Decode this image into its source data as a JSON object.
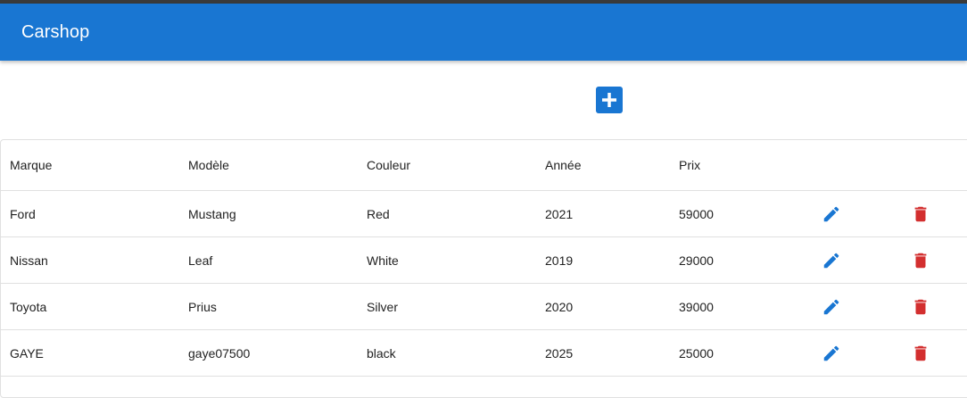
{
  "app": {
    "title": "Carshop"
  },
  "toolbar": {
    "add_icon": "plus-icon"
  },
  "table": {
    "columns": [
      "Marque",
      "Modèle",
      "Couleur",
      "Année",
      "Prix"
    ],
    "rows": [
      {
        "marque": "Ford",
        "modele": "Mustang",
        "couleur": "Red",
        "annee": "2021",
        "prix": "59000"
      },
      {
        "marque": "Nissan",
        "modele": "Leaf",
        "couleur": "White",
        "annee": "2019",
        "prix": "29000"
      },
      {
        "marque": "Toyota",
        "modele": "Prius",
        "couleur": "Silver",
        "annee": "2020",
        "prix": "39000"
      },
      {
        "marque": "GAYE",
        "modele": "gaye07500",
        "couleur": "black",
        "annee": "2025",
        "prix": "25000"
      }
    ],
    "row_icons": {
      "edit": "pencil-icon",
      "delete": "trash-icon"
    }
  },
  "colors": {
    "primary": "#1976d2",
    "delete": "#d32f2f",
    "border": "#e0e0e0",
    "text": "#222222"
  }
}
